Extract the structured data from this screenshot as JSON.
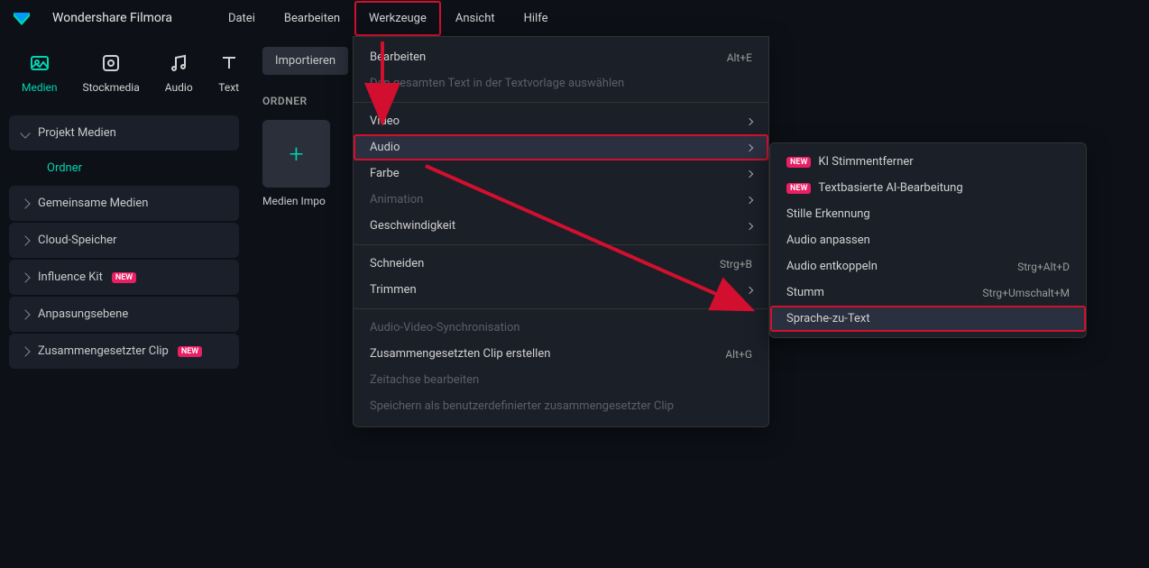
{
  "app": {
    "title": "Wondershare Filmora"
  },
  "menubar": {
    "items": [
      "Datei",
      "Bearbeiten",
      "Werkzeuge",
      "Ansicht",
      "Hilfe"
    ],
    "highlighted_index": 2
  },
  "navtabs": {
    "items": [
      {
        "label": "Medien",
        "active": true
      },
      {
        "label": "Stockmedia",
        "active": false
      },
      {
        "label": "Audio",
        "active": false
      },
      {
        "label": "Text",
        "active": false
      }
    ]
  },
  "sidebar": {
    "items": [
      {
        "label": "Projekt Medien",
        "expanded": true,
        "sub": "Ordner"
      },
      {
        "label": "Gemeinsame Medien"
      },
      {
        "label": "Cloud-Speicher"
      },
      {
        "label": "Influence Kit",
        "badge": "NEW"
      },
      {
        "label": "Anpasungsebene"
      },
      {
        "label": "Zusammengesetzter Clip",
        "badge": "NEW"
      }
    ]
  },
  "content": {
    "import_button": "Importieren",
    "section_label": "ORDNER",
    "tile_caption": "Medien Impo"
  },
  "dropdown_tools": {
    "groups": [
      [
        {
          "label": "Bearbeiten",
          "shortcut": "Alt+E"
        },
        {
          "label": "Den gesamten Text in der Textvorlage auswählen",
          "disabled": true
        }
      ],
      [
        {
          "label": "Video",
          "submenu": true
        },
        {
          "label": "Audio",
          "submenu": true,
          "hover": true,
          "boxed": true
        },
        {
          "label": "Farbe",
          "submenu": true
        },
        {
          "label": "Animation",
          "submenu": true,
          "disabled": true
        },
        {
          "label": "Geschwindigkeit",
          "submenu": true
        }
      ],
      [
        {
          "label": "Schneiden",
          "shortcut": "Strg+B"
        },
        {
          "label": "Trimmen",
          "submenu": true
        }
      ],
      [
        {
          "label": "Audio-Video-Synchronisation",
          "disabled": true
        },
        {
          "label": "Zusammengesetzten Clip erstellen",
          "shortcut": "Alt+G"
        },
        {
          "label": "Zeitachse bearbeiten",
          "disabled": true
        },
        {
          "label": "Speichern als benutzerdefinierter zusammengesetzter Clip",
          "disabled": true
        }
      ]
    ]
  },
  "dropdown_audio": {
    "items": [
      {
        "label": "KI Stimmentferner",
        "badge": "NEW"
      },
      {
        "label": "Textbasierte AI-Bearbeitung",
        "badge": "NEW"
      },
      {
        "label": "Stille Erkennung"
      },
      {
        "label": "Audio anpassen"
      },
      {
        "label": "Audio entkoppeln",
        "shortcut": "Strg+Alt+D"
      },
      {
        "label": "Stumm",
        "shortcut": "Strg+Umschalt+M"
      },
      {
        "label": "Sprache-zu-Text",
        "hover": true,
        "boxed": true
      }
    ]
  }
}
